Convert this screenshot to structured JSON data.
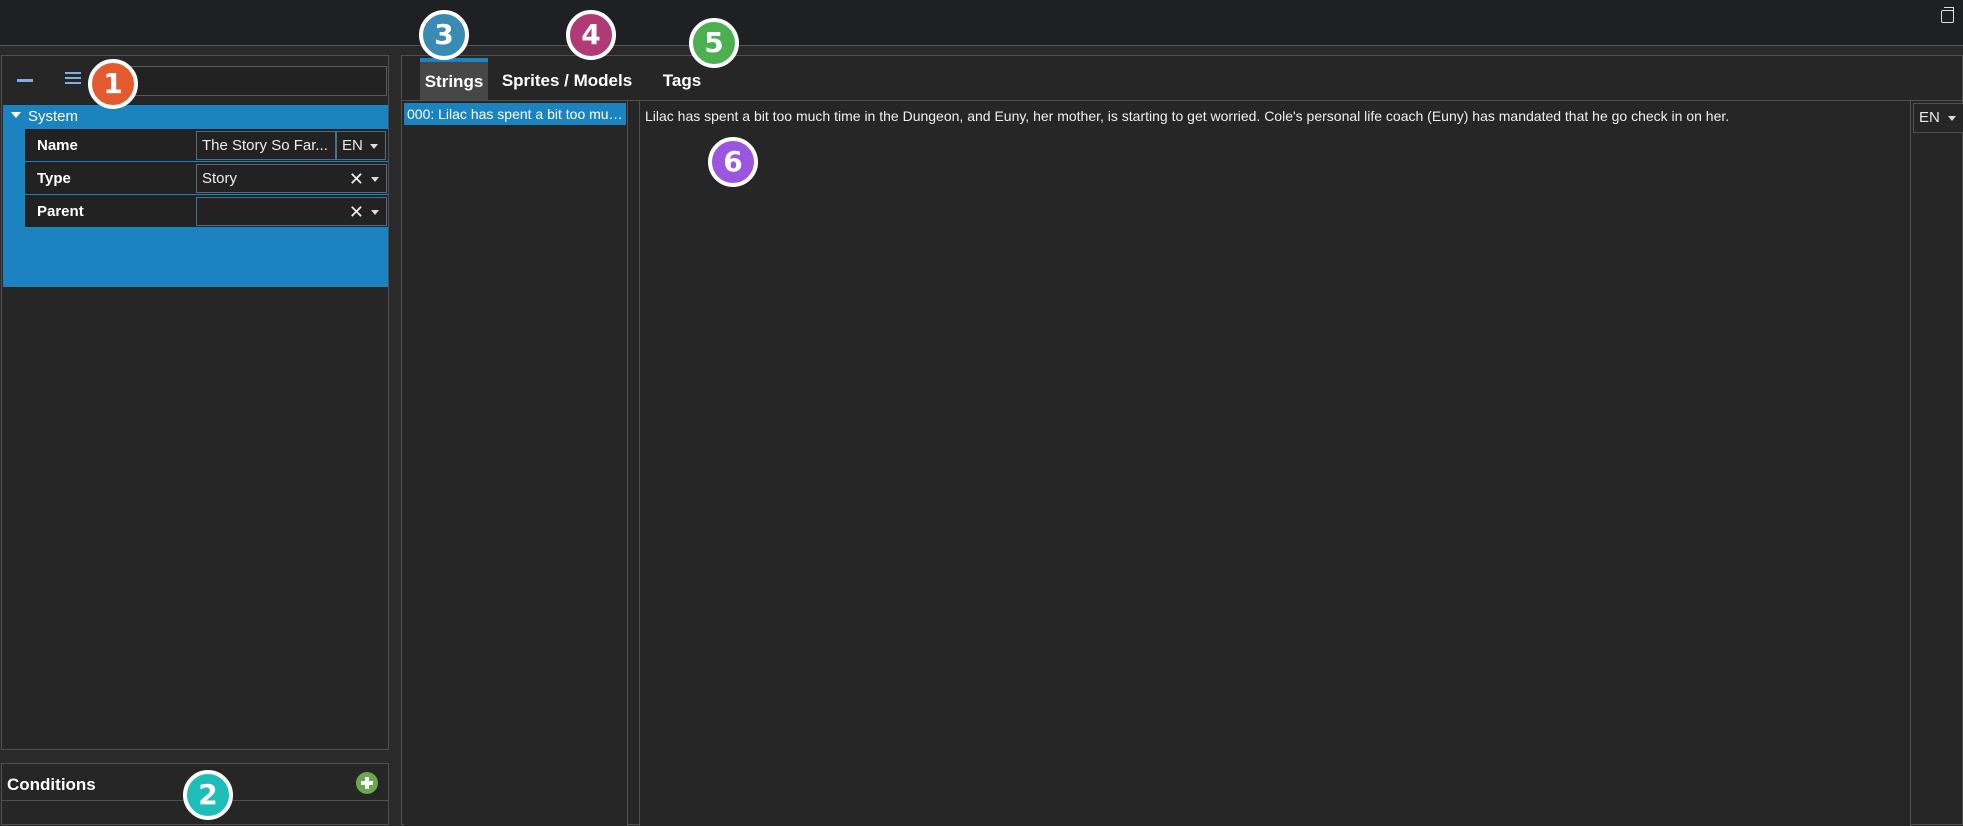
{
  "property_panel": {
    "search": {
      "value": "",
      "placeholder": ""
    },
    "category": "System",
    "rows": [
      {
        "label": "Name",
        "value": "The Story So Far...",
        "lang": "EN"
      },
      {
        "label": "Type",
        "value": "Story"
      },
      {
        "label": "Parent",
        "value": ""
      }
    ]
  },
  "conditions": {
    "title": "Conditions"
  },
  "tabs": [
    {
      "label": "Strings",
      "active": true
    },
    {
      "label": "Sprites / Models",
      "active": false
    },
    {
      "label": "Tags",
      "active": false
    }
  ],
  "strings": {
    "items": [
      "000: Lilac has spent a bit too much time in the Dungeon, and Euny, her mother, is starting to get worried.  Cole's personal life coach (Euny) has mandated that he go check in on her."
    ],
    "editor_text": "Lilac has spent a bit too much time in the Dungeon, and Euny, her mother, is starting to get worried.  Cole's personal life coach (Euny) has mandated that he go check in on her.",
    "editor_lang": "EN"
  },
  "badges": [
    {
      "number": "1",
      "color": "#e35a2f"
    },
    {
      "number": "2",
      "color": "#1fbdb8"
    },
    {
      "number": "3",
      "color": "#3a8bb4"
    },
    {
      "number": "4",
      "color": "#b03a73"
    },
    {
      "number": "5",
      "color": "#4cb050"
    },
    {
      "number": "6",
      "color": "#9b55e0"
    }
  ],
  "colors": {
    "accent": "#1b84c0",
    "background": "#262626",
    "topbar": "#1f2023"
  }
}
